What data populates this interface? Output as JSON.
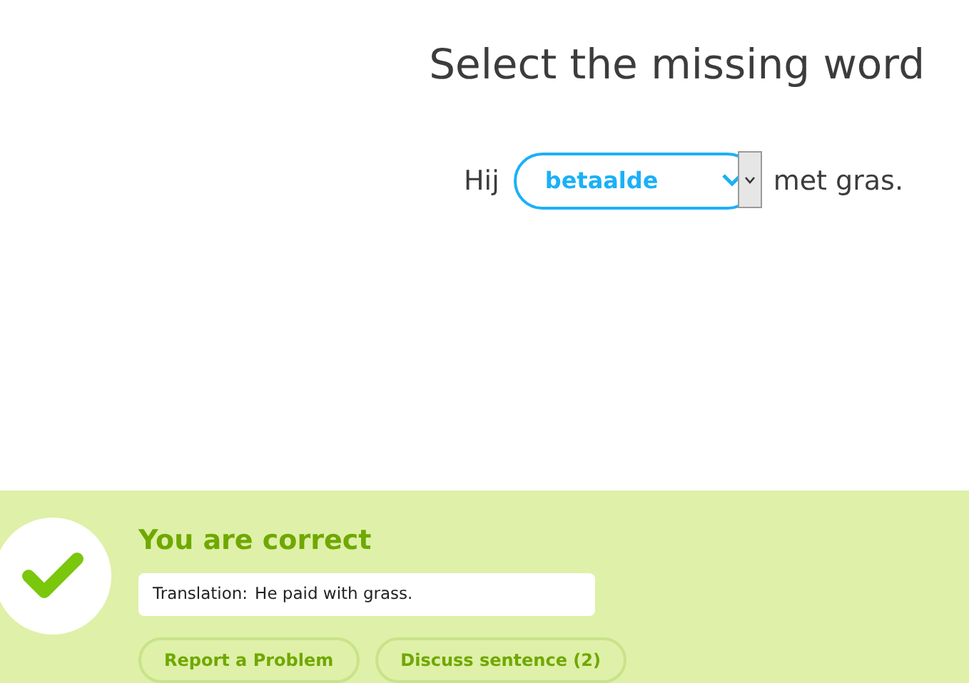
{
  "prompt": {
    "title": "Select the missing word"
  },
  "sentence": {
    "before": "Hij",
    "selected_word": "betaalde",
    "after": "met gras."
  },
  "result": {
    "kind": "correct",
    "heading": "You are correct",
    "translation_label": "Translation:",
    "translation": "He paid with grass."
  },
  "buttons": [
    "Report a Problem",
    "Discuss sentence (2)"
  ]
}
